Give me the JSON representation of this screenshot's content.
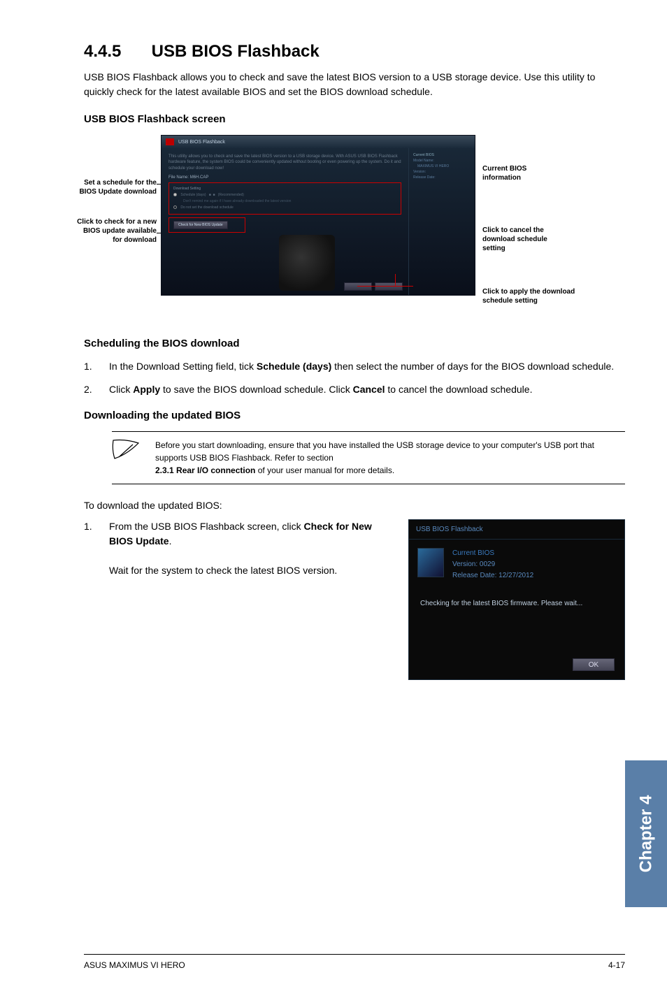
{
  "section": {
    "number": "4.4.5",
    "title": "USB BIOS Flashback"
  },
  "intro": "USB BIOS Flashback allows you to check and save the latest BIOS version to a USB storage device. Use this utility to quickly check for the latest available BIOS and set the BIOS download schedule.",
  "sub1": "USB BIOS Flashback screen",
  "screenshot_labels": {
    "left1": "Set a schedule for the BIOS Update download",
    "left2": "Click to check for a new BIOS update available for download",
    "right1": "Current BIOS information",
    "right2": "Click to cancel the download schedule setting",
    "right3": "Click to apply the download schedule setting"
  },
  "screenshot_ui": {
    "window_title": "USB BIOS Flashback",
    "blurb": "This utility allows you to check and save the latest BIOS version to a USB storage device. With ASUS USB BIOS Flashback hardware feature, the system BIOS could be conveniently updated without booting or even powering up the system. Do it and schedule your download now!",
    "file_label": "File Name:",
    "file_value": "M6H.CAP",
    "box_title": "Download Setting",
    "sched_label": "Schedule (days)",
    "sched_rec": "(Recommended)",
    "sched_hint": "Don't remind me again if I have already downloaded the latest version",
    "nosched": "Do not set the download schedule",
    "check_btn": "Check for New BIOS Update",
    "right_hdr": "Current BIOS",
    "right_model": "Model Name:",
    "right_model_v": "MAXIMUS VI HERO",
    "right_ver": "Version:",
    "right_date": "Release Date:",
    "apply": "Apply",
    "cancel": "Cancel"
  },
  "sub2": "Scheduling the BIOS download",
  "steps1": [
    {
      "n": "1.",
      "pre": "In the Download Setting field, tick ",
      "bold": "Schedule (days)",
      "post": " then select the number of days for the BIOS download schedule."
    },
    {
      "n": "2.",
      "pre": "Click ",
      "bold": "Apply",
      "mid": " to save the BIOS download schedule. Click ",
      "bold2": "Cancel",
      "post": " to cancel the download schedule."
    }
  ],
  "sub3": "Downloading the updated BIOS",
  "note": {
    "l1": "Before you start downloading, ensure that you have installed the USB storage device to your computer's USB port that supports USB BIOS Flashback. Refer to section ",
    "l2b": "2.3.1 Rear I/O connection",
    "l2": " of your user manual for more details."
  },
  "dl_intro": "To download the updated BIOS:",
  "steps2": {
    "n": "1.",
    "pre": "From the USB BIOS Flashback screen, click ",
    "bold": "Check for New BIOS Update",
    "post": ".",
    "wait": "Wait for the system to check the latest BIOS version."
  },
  "dialog": {
    "title": "USB BIOS Flashback",
    "cur": "Current BIOS",
    "ver": "Version:  0029",
    "date": "Release Date:  12/27/2012",
    "checking": "Checking for the latest BIOS firmware. Please wait...",
    "ok": "OK"
  },
  "sidetab": "Chapter 4",
  "footer": {
    "left": "ASUS MAXIMUS VI HERO",
    "right": "4-17"
  }
}
